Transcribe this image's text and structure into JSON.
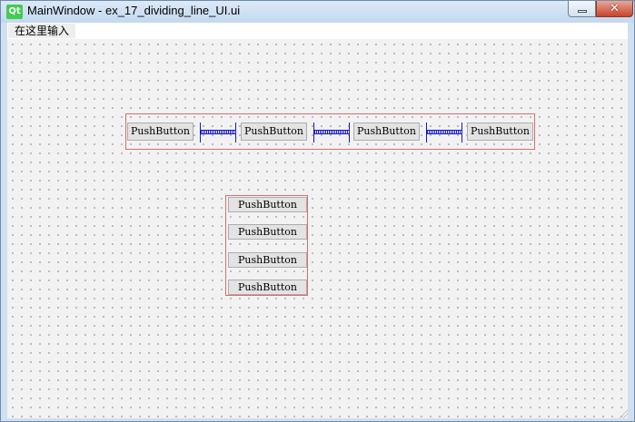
{
  "window": {
    "title": "MainWindow - ex_17_dividing_line_UI.ui",
    "app_icon_text": "Qt",
    "close_glyph": "✕"
  },
  "menubar": {
    "placeholder_item": "在这里输入"
  },
  "horizontal_layout": {
    "buttons": [
      "PushButton",
      "PushButton",
      "PushButton",
      "PushButton"
    ]
  },
  "vertical_layout": {
    "buttons": [
      "PushButton",
      "PushButton",
      "PushButton",
      "PushButton"
    ]
  },
  "colors": {
    "layout_border": "#e06a6a",
    "spacer": "#1818c8",
    "qt_green": "#41cd52"
  }
}
